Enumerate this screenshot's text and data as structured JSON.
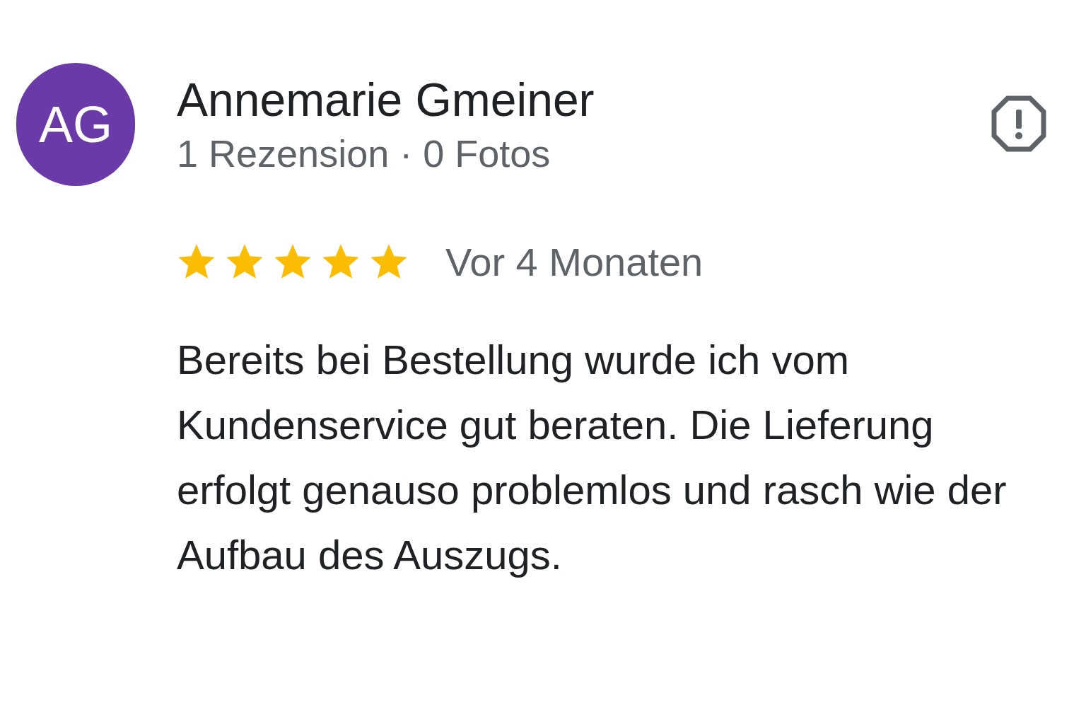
{
  "review": {
    "avatar": {
      "initials": "AG",
      "color": "#6a3aa8"
    },
    "author": "Annemarie Gmeiner",
    "meta": "1 Rezension · 0 Fotos",
    "stars": 5,
    "date": "Vor 4 Monaten",
    "text": "Bereits bei Bestellung wurde ich vom Kundenservice gut beraten. Die Lieferung erfolgt genauso problemlos und rasch wie der Aufbau des Auszugs."
  }
}
